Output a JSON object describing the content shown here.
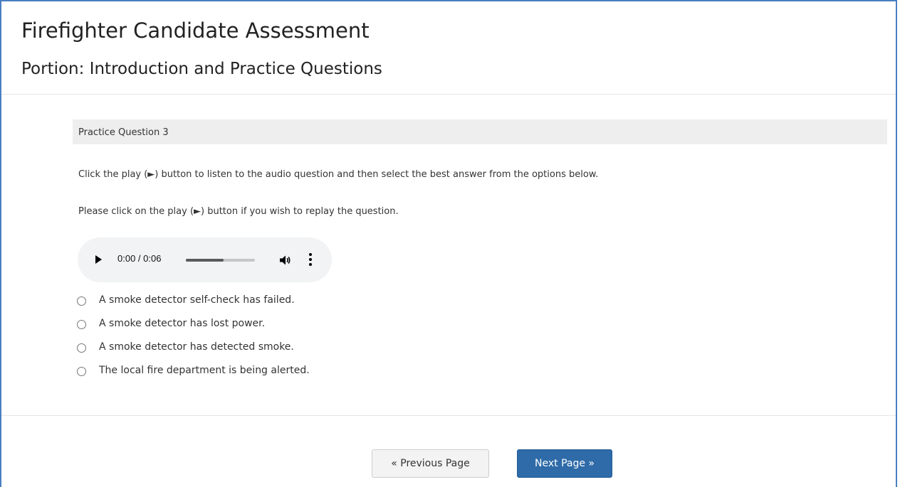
{
  "header": {
    "title": "Firefighter Candidate Assessment",
    "subtitle": "Portion: Introduction and Practice Questions"
  },
  "question": {
    "label": "Practice Question 3",
    "instruction_1": "Click the play (►) button to listen to the audio question and then select the best answer from the options below.",
    "instruction_2": "Please click on the play (►) button if you wish to replay the question."
  },
  "audio_player": {
    "time_display": "0:00 / 0:06",
    "buffered_fraction": 0.55,
    "play_icon": "play-icon",
    "volume_icon": "volume-icon",
    "menu_icon": "more-vertical-icon"
  },
  "options": [
    {
      "label": "A smoke detector self-check has failed.",
      "selected": false
    },
    {
      "label": "A smoke detector has lost power.",
      "selected": false
    },
    {
      "label": "A smoke detector has detected smoke.",
      "selected": false
    },
    {
      "label": "The local fire department is being alerted.",
      "selected": false
    }
  ],
  "navigation": {
    "previous_label": "« Previous Page",
    "next_label": "Next Page »"
  },
  "colors": {
    "frame_border": "#4a7fc1",
    "next_button": "#2e6ba8",
    "question_bar": "#eeeeee"
  }
}
